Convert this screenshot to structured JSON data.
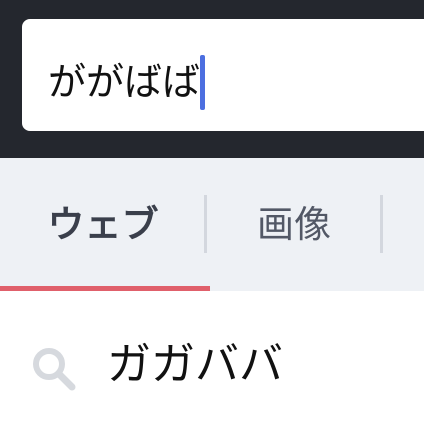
{
  "search": {
    "query": "ががばば"
  },
  "tabs": [
    {
      "label": "ウェブ",
      "active": true
    },
    {
      "label": "画像",
      "active": false
    }
  ],
  "suggestions": [
    {
      "text": "ガガババ",
      "icon": "search-icon"
    }
  ],
  "colors": {
    "header_bg": "#24272e",
    "caret": "#4c6fe0",
    "tab_bar_bg": "#eef1f5",
    "active_underline": "#e0606b"
  }
}
